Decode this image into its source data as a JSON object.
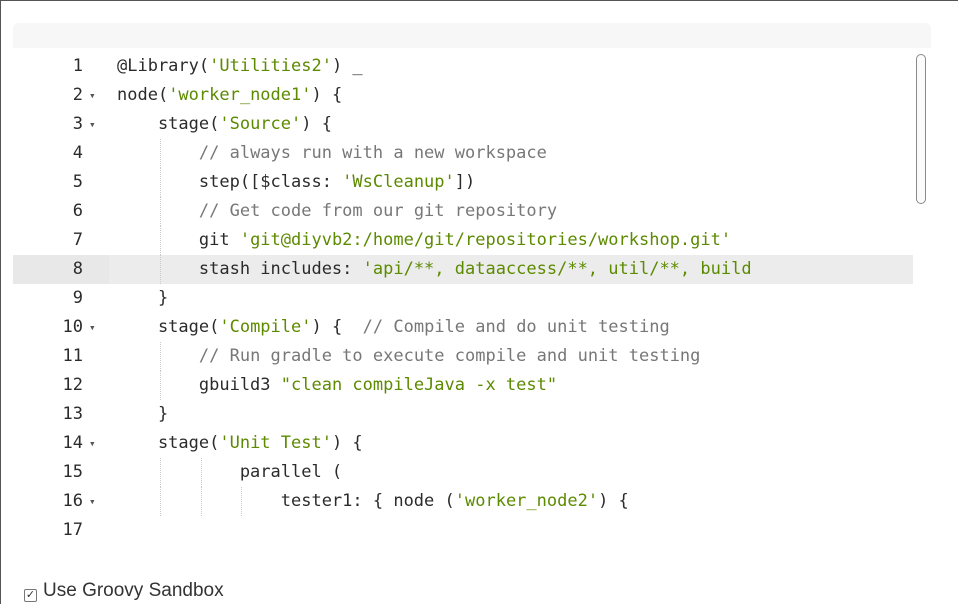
{
  "editor": {
    "active_line": 8,
    "lines": [
      {
        "n": "1",
        "fold": false,
        "indent": 0,
        "tokens": [
          {
            "t": "@Library(",
            "c": ""
          },
          {
            "t": "'Utilities2'",
            "c": "str"
          },
          {
            "t": ") _",
            "c": ""
          }
        ]
      },
      {
        "n": "2",
        "fold": true,
        "indent": 0,
        "tokens": [
          {
            "t": "node(",
            "c": ""
          },
          {
            "t": "'worker_node1'",
            "c": "str"
          },
          {
            "t": ") {",
            "c": ""
          }
        ]
      },
      {
        "n": "3",
        "fold": true,
        "indent": 1,
        "tokens": [
          {
            "t": "    stage(",
            "c": ""
          },
          {
            "t": "'Source'",
            "c": "str"
          },
          {
            "t": ") {",
            "c": ""
          }
        ]
      },
      {
        "n": "4",
        "fold": false,
        "indent": 2,
        "tokens": [
          {
            "t": "        ",
            "c": ""
          },
          {
            "t": "// always run with a new workspace",
            "c": "cmt"
          }
        ]
      },
      {
        "n": "5",
        "fold": false,
        "indent": 2,
        "tokens": [
          {
            "t": "        step([$class: ",
            "c": ""
          },
          {
            "t": "'WsCleanup'",
            "c": "str"
          },
          {
            "t": "])",
            "c": ""
          }
        ]
      },
      {
        "n": "6",
        "fold": false,
        "indent": 2,
        "tokens": [
          {
            "t": "        ",
            "c": ""
          },
          {
            "t": "// Get code from our git repository",
            "c": "cmt"
          }
        ]
      },
      {
        "n": "7",
        "fold": false,
        "indent": 2,
        "tokens": [
          {
            "t": "        git ",
            "c": ""
          },
          {
            "t": "'git@diyvb2:/home/git/repositories/workshop.git'",
            "c": "str"
          }
        ]
      },
      {
        "n": "8",
        "fold": false,
        "indent": 2,
        "tokens": [
          {
            "t": "        stash includes: ",
            "c": ""
          },
          {
            "t": "'api/**, dataaccess/**, util/**, build",
            "c": "str"
          }
        ]
      },
      {
        "n": "9",
        "fold": false,
        "indent": 1,
        "tokens": [
          {
            "t": "    }",
            "c": ""
          }
        ]
      },
      {
        "n": "10",
        "fold": true,
        "indent": 1,
        "tokens": [
          {
            "t": "    stage(",
            "c": ""
          },
          {
            "t": "'Compile'",
            "c": "str"
          },
          {
            "t": ") {  ",
            "c": ""
          },
          {
            "t": "// Compile and do unit testing",
            "c": "cmt"
          }
        ]
      },
      {
        "n": "11",
        "fold": false,
        "indent": 2,
        "tokens": [
          {
            "t": "        ",
            "c": ""
          },
          {
            "t": "// Run gradle to execute compile and unit testing",
            "c": "cmt"
          }
        ]
      },
      {
        "n": "12",
        "fold": false,
        "indent": 2,
        "tokens": [
          {
            "t": "        gbuild3 ",
            "c": ""
          },
          {
            "t": "\"clean compileJava -x test\"",
            "c": "str"
          }
        ]
      },
      {
        "n": "13",
        "fold": false,
        "indent": 1,
        "tokens": [
          {
            "t": "    }",
            "c": ""
          }
        ]
      },
      {
        "n": "14",
        "fold": true,
        "indent": 1,
        "tokens": [
          {
            "t": "    stage(",
            "c": ""
          },
          {
            "t": "'Unit Test'",
            "c": "str"
          },
          {
            "t": ") {",
            "c": ""
          }
        ]
      },
      {
        "n": "15",
        "fold": false,
        "indent": 3,
        "tokens": [
          {
            "t": "            parallel (",
            "c": ""
          }
        ]
      },
      {
        "n": "16",
        "fold": true,
        "indent": 4,
        "tokens": [
          {
            "t": "                tester1: { node (",
            "c": ""
          },
          {
            "t": "'worker_node2'",
            "c": "str"
          },
          {
            "t": ") {",
            "c": ""
          }
        ]
      },
      {
        "n": "17",
        "fold": false,
        "indent": 0,
        "tokens": []
      }
    ],
    "vertical_scroll_fraction": 0.0,
    "horizontal_scroll_fraction": 0.0
  },
  "sandbox": {
    "label": "Use Groovy Sandbox",
    "checked": true,
    "check_glyph": "✓"
  }
}
